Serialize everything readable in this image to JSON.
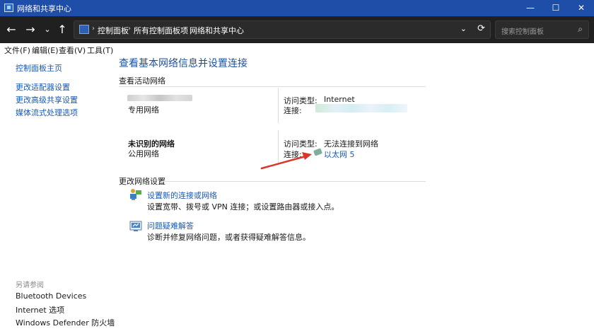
{
  "window": {
    "title": "网络和共享中心"
  },
  "address": {
    "crumbs": [
      "控制面板",
      "所有控制面板项",
      "网络和共享中心"
    ],
    "search_placeholder": "搜索控制面板"
  },
  "menu": [
    "文件(F)",
    "编辑(E)",
    "查看(V)",
    "工具(T)"
  ],
  "sidebar": {
    "links": [
      "控制面板主页",
      "更改适配器设置",
      "更改高级共享设置",
      "媒体流式处理选项"
    ],
    "see_also_title": "另请参阅",
    "see_also": [
      "Bluetooth Devices",
      "Internet 选项",
      "Windows Defender 防火墙"
    ]
  },
  "main": {
    "title": "查看基本网络信息并设置连接",
    "active_section": "查看活动网络",
    "networks": [
      {
        "name": "",
        "category": "专用网络",
        "access_label": "访问类型:",
        "access_value": "Internet",
        "conn_label": "连接:",
        "conn_value": ""
      },
      {
        "name": "未识别的网络",
        "category": "公用网络",
        "access_label": "访问类型:",
        "access_value": "无法连接到网络",
        "conn_label": "连接:",
        "conn_value": "以太网 5"
      }
    ],
    "change_section": "更改网络设置",
    "tasks": [
      {
        "link": "设置新的连接或网络",
        "desc": "设置宽带、拨号或 VPN 连接；或设置路由器或接入点。"
      },
      {
        "link": "问题疑难解答",
        "desc": "诊断并修复网络问题，或者获得疑难解答信息。"
      }
    ]
  },
  "colors": {
    "titlebar": "#1e4ea8",
    "addressbar": "#202020",
    "link": "#1a58b5",
    "heading": "#1e4f9e",
    "annotation_arrow": "#d9372c"
  }
}
